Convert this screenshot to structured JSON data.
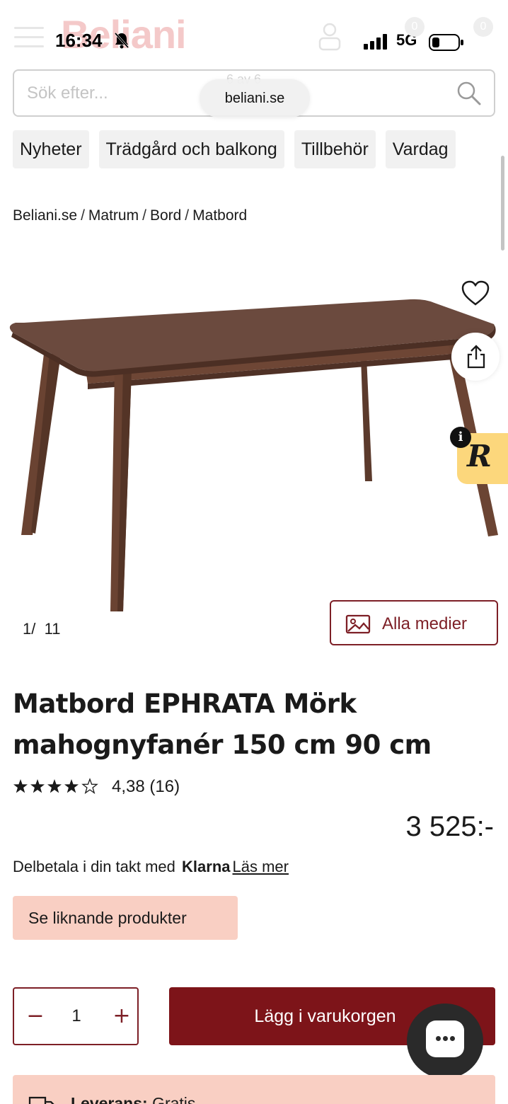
{
  "status_bar": {
    "time": "16:34",
    "network": "5G"
  },
  "header": {
    "logo": "Beliani",
    "wishlist_count": "0",
    "cart_count": "0"
  },
  "search": {
    "placeholder": "Sök efter...",
    "url_pill": "beliani.se",
    "ghost_text": "6 av 6"
  },
  "categories": [
    "Nyheter",
    "Trädgård och balkong",
    "Tillbehör",
    "Vardag"
  ],
  "breadcrumb": [
    "Beliani.se",
    "Matrum",
    "Bord",
    "Matbord"
  ],
  "gallery": {
    "current": "1",
    "separator": "/",
    "total": "11",
    "all_media_label": "Alla medier"
  },
  "product": {
    "title": "Matbord EPHRATA Mörk mahognyfanér 150 cm 90 cm",
    "rating_value": 4.38,
    "rating_text": "4,38 (16)",
    "price": "3 525:-"
  },
  "payment": {
    "text": "Delbetala i din takt med",
    "brand": "Klarna",
    "link": "Läs mer"
  },
  "similar_button": "Se liknande produkter",
  "cart": {
    "minus": "−",
    "quantity": "1",
    "plus": "+",
    "add_label": "Lägg i varukorgen"
  },
  "delivery": {
    "label": "Leverans:",
    "value": "Gratis"
  },
  "widgets": {
    "r_letter": "R",
    "info_letter": "i"
  },
  "colors": {
    "brand_red": "#7d1419",
    "accent_peach": "#f9cfc3",
    "widget_yellow": "#fcd77c"
  }
}
